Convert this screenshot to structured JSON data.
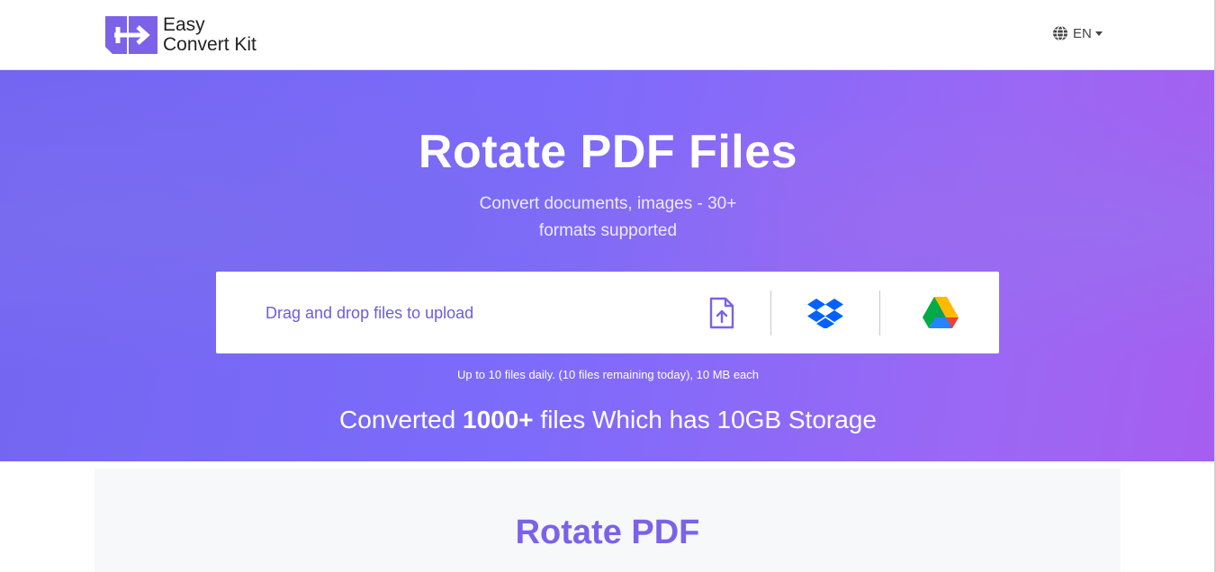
{
  "brand": {
    "name_line1": "Easy",
    "name_line2": "Convert Kit",
    "logo_color": "#7b62e8"
  },
  "language": {
    "icon": "globe-icon",
    "label": "EN"
  },
  "hero": {
    "title": "Rotate PDF Files",
    "subtitle_line1": "Convert documents, images - 30+",
    "subtitle_line2": "formats supported"
  },
  "upload": {
    "drop_text": "Drag and drop files to upload",
    "sources": [
      {
        "name": "device",
        "icon": "file-upload-icon"
      },
      {
        "name": "dropbox",
        "icon": "dropbox-icon"
      },
      {
        "name": "google-drive",
        "icon": "google-drive-icon"
      }
    ],
    "limits_text": "Up to 10 files daily. (10 files remaining today), 10 MB each"
  },
  "stats": {
    "prefix": "Converted ",
    "count": "1000+",
    "suffix": " files Which has 10GB Storage"
  },
  "section": {
    "title": "Rotate PDF"
  },
  "colors": {
    "accent": "#7b62e8",
    "hero_start": "#7466f1",
    "hero_end": "#a65ef0",
    "dropbox": "#0061fe"
  }
}
